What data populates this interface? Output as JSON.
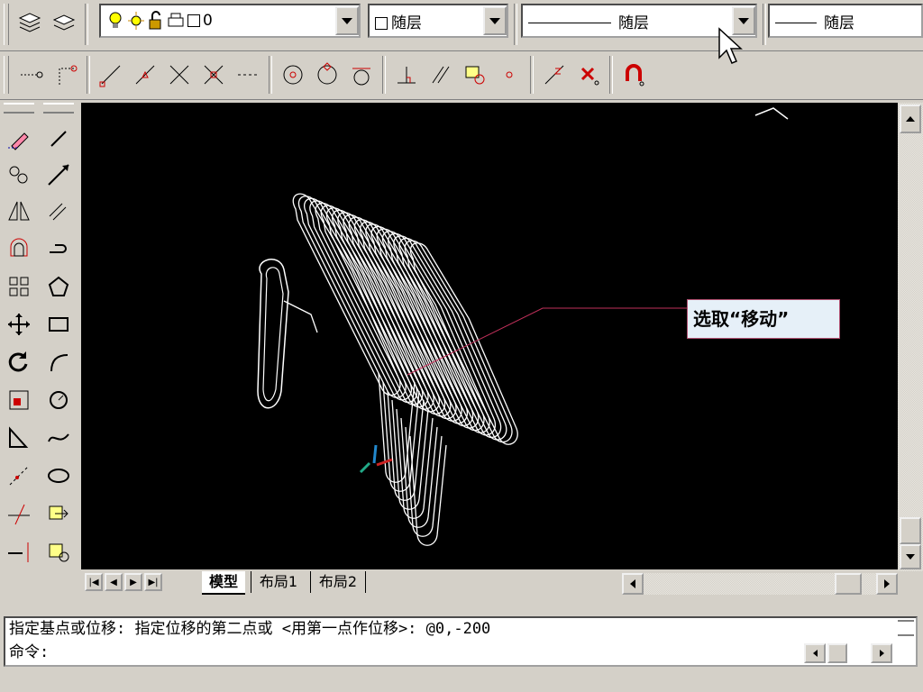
{
  "toolbar_layer": {
    "layer_combo": {
      "value": "0"
    },
    "color_combo": {
      "value": "随层"
    },
    "linetype_combo": {
      "value": "随层"
    },
    "lineweight_combo": {
      "value": "随层"
    }
  },
  "layout_tabs": [
    "模型",
    "布局1",
    "布局2"
  ],
  "annotation": {
    "label": "选取“移动”"
  },
  "command_line": {
    "history": "指定基点或位移: 指定位移的第二点或 <用第一点作位移>: @0,-200",
    "prompt": "命令:"
  },
  "colors": {
    "viewport_bg": "#000000",
    "window_bg": "#d4d0c8",
    "callout_border": "#b05070",
    "drawing": "#ffffff"
  }
}
